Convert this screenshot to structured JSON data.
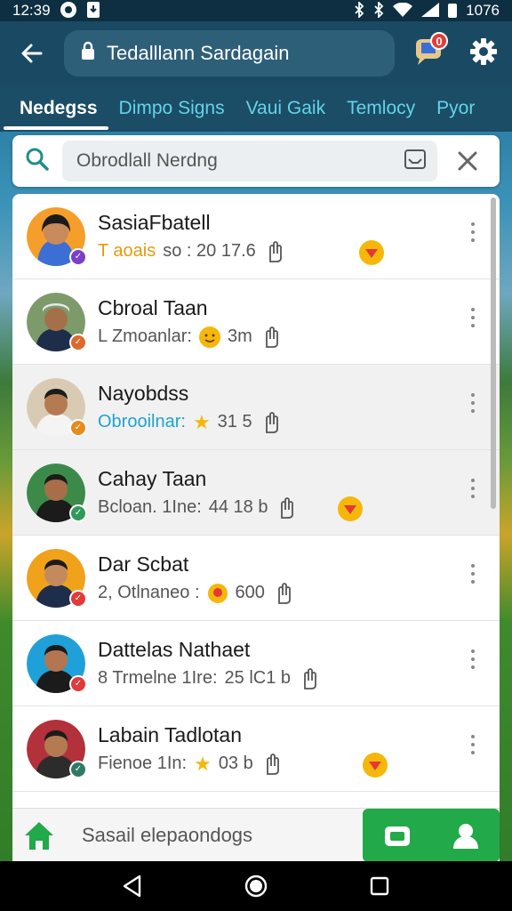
{
  "status_bar": {
    "time": "12:39",
    "battery": "1076"
  },
  "app_bar": {
    "title": "Tedalllann Sardagain",
    "notification_count": "0"
  },
  "tabs": [
    {
      "label": "Nedegss",
      "active": true
    },
    {
      "label": "Dimpo Signs",
      "active": false
    },
    {
      "label": "Vaui Gaik",
      "active": false
    },
    {
      "label": "Temlocy",
      "active": false
    },
    {
      "label": "Pyor",
      "active": false
    }
  ],
  "search": {
    "placeholder": "Obrodlall Nerdng"
  },
  "contacts": [
    {
      "name": "SasiaFbatell",
      "meta_prefix": "T aoais",
      "meta_rest": "so : 20  17.6",
      "presence_color": "#7b3fc9"
    },
    {
      "name": "Cbroal Taan",
      "meta_prefix": "L Zmoanlar:",
      "meta_rest": "3m",
      "presence_color": "#e0672a"
    },
    {
      "name": "Nayobdss",
      "meta_prefix": "Obrooilnar:",
      "meta_rest": "31 5",
      "presence_color": "#e88b1f"
    },
    {
      "name": "Cahay Taan",
      "meta_prefix": "Bcloan. 1Ine:",
      "meta_rest": "44 18 b",
      "presence_color": "#2f9b5a"
    },
    {
      "name": "Dar Scbat",
      "meta_prefix": "2, Otlnaneo :",
      "meta_rest": "600",
      "presence_color": "#e13a3a"
    },
    {
      "name": "Dattelas Nathaet",
      "meta_prefix": "8 Trmelne 1Ire:",
      "meta_rest": "25  lC1 b",
      "presence_color": "#e13a3a"
    },
    {
      "name": "Labain Tadlotan",
      "meta_prefix": "Fienoe 1In:",
      "meta_rest": "03 b",
      "presence_color": "#2f7a68"
    }
  ],
  "bottom_bar": {
    "compose_label": "Sasail elepaondogs"
  },
  "colors": {
    "app_bar": "#1a4a63",
    "tab_active": "#ffffff",
    "tab_inactive": "#64d3e8",
    "accent_green": "#22a94a",
    "search_icon": "#1f8e86"
  }
}
